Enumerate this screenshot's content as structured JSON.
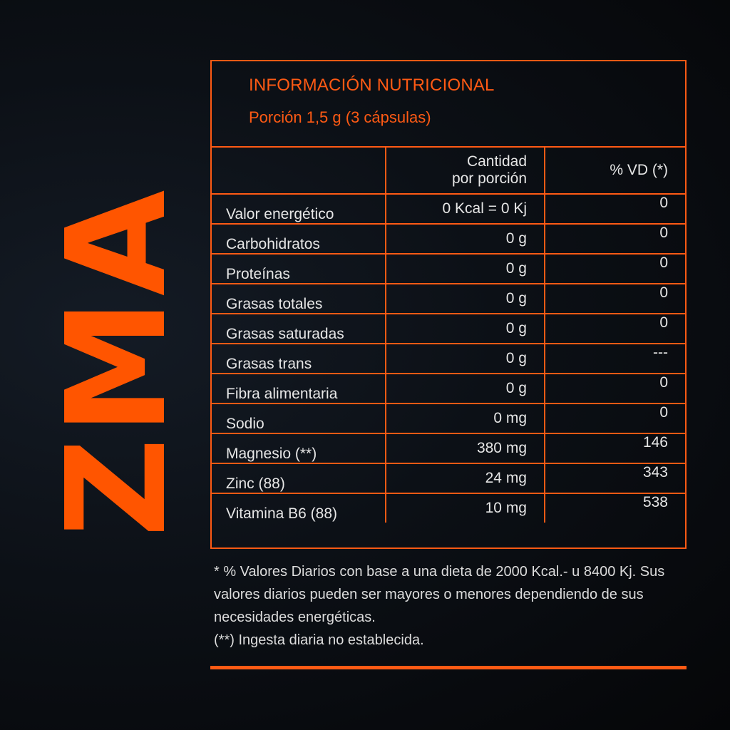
{
  "brand": {
    "logo_text": "ZMA"
  },
  "panel": {
    "title": "INFORMACIÓN NUTRICIONAL",
    "serving": "Porción 1,5 g (3 cápsulas)",
    "columns": {
      "amount_line1": "Cantidad",
      "amount_line2": "por porción",
      "dv": "% VD (*)"
    },
    "rows": [
      {
        "name": "Valor energético",
        "amount": "0 Kcal = 0 Kj",
        "dv": "0"
      },
      {
        "name": "Carbohidratos",
        "amount": "0 g",
        "dv": "0"
      },
      {
        "name": "Proteínas",
        "amount": "0 g",
        "dv": "0"
      },
      {
        "name": "Grasas totales",
        "amount": "0 g",
        "dv": "0"
      },
      {
        "name": "Grasas saturadas",
        "amount": "0 g",
        "dv": "0"
      },
      {
        "name": "Grasas trans",
        "amount": "0 g",
        "dv": "---"
      },
      {
        "name": "Fibra alimentaria",
        "amount": "0 g",
        "dv": "0"
      },
      {
        "name": "Sodio",
        "amount": "0 mg",
        "dv": "0"
      },
      {
        "name": "Magnesio (**)",
        "amount": "380 mg",
        "dv": "146"
      },
      {
        "name": "Zinc (88)",
        "amount": "24 mg",
        "dv": "343"
      },
      {
        "name": "Vitamina B6 (88)",
        "amount": "10 mg",
        "dv": "538"
      }
    ]
  },
  "footnotes": {
    "daily_values": "* % Valores Diarios con base a una dieta de 2000 Kcal.- u 8400 Kj. Sus valores diarios pueden ser mayores o menores dependiendo de sus necesidades energéticas.",
    "intake": "(**) Ingesta diaria no establecida."
  },
  "colors": {
    "accent": "#ff5a14",
    "background": "#0c1016",
    "text": "#e6e6e6"
  }
}
